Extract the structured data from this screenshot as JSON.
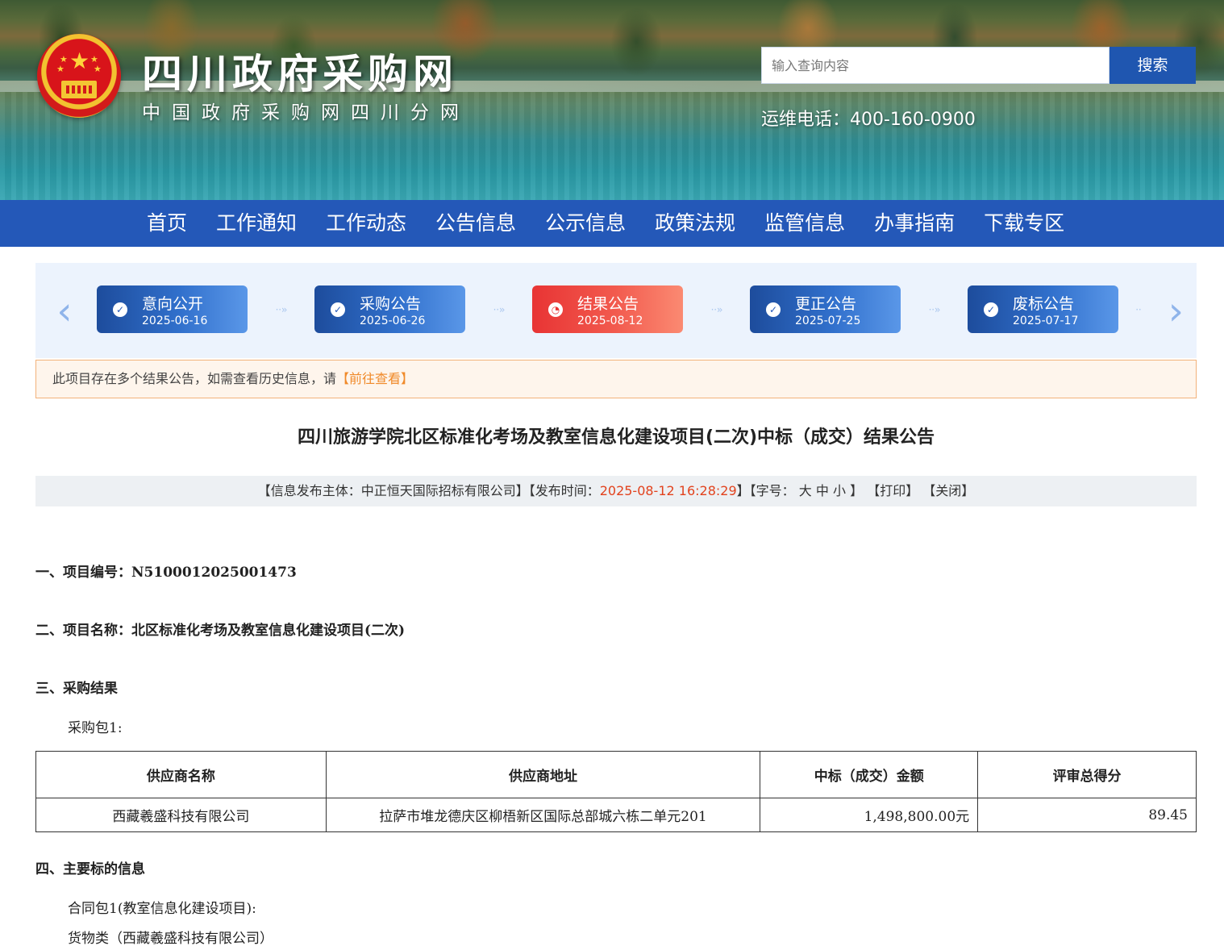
{
  "header": {
    "site_title": "四川政府采购网",
    "site_subtitle": "中国政府采购网四川分网",
    "search_placeholder": "输入查询内容",
    "search_button": "搜索",
    "hotline": "运维电话：400-160-0900"
  },
  "nav": {
    "items": [
      "首页",
      "工作通知",
      "工作动态",
      "公告信息",
      "公示信息",
      "政策法规",
      "监管信息",
      "办事指南",
      "下载专区"
    ]
  },
  "steps": [
    {
      "title": "意向公开",
      "date": "2025-06-16",
      "active": false
    },
    {
      "title": "采购公告",
      "date": "2025-06-26",
      "active": false
    },
    {
      "title": "结果公告",
      "date": "2025-08-12",
      "active": true
    },
    {
      "title": "更正公告",
      "date": "2025-07-25",
      "active": false
    },
    {
      "title": "废标公告",
      "date": "2025-07-17",
      "active": false
    }
  ],
  "notice": {
    "text": "此项目存在多个结果公告，如需查看历史信息，请",
    "link": "【前往查看】"
  },
  "article": {
    "title": "四川旅游学院北区标准化考场及教室信息化建设项目(二次)中标（成交）结果公告",
    "meta": {
      "publisher_prefix": "【信息发布主体：中正恒天国际招标有限公司】【发布时间：",
      "time": "2025-08-12 16:28:29",
      "fontsize_prefix": "】【字号：",
      "size_large": "大",
      "size_medium": "中",
      "size_small": "小",
      "fontsize_suffix": "】",
      "print": "【打印】",
      "close": "【关闭】"
    },
    "sections": {
      "s1": "一、项目编号：N5100012025001473",
      "s2": "二、项目名称：北区标准化考场及教室信息化建设项目(二次)",
      "s3": "三、采购结果",
      "s3_package": "采购包1:",
      "s4": "四、主要标的信息",
      "s4_contract": "合同包1(教室信息化建设项目):",
      "s4_category": "货物类（西藏羲盛科技有限公司）"
    },
    "result_table": {
      "headers": [
        "供应商名称",
        "供应商地址",
        "中标（成交）金额",
        "评审总得分"
      ],
      "rows": [
        [
          "西藏羲盛科技有限公司",
          "拉萨市堆龙德庆区柳梧新区国际总部城六栋二单元201",
          "1,498,800.00元",
          "89.45"
        ]
      ]
    }
  },
  "colors": {
    "nav_bg": "#2458b8",
    "step_active": "#e83434",
    "time_text": "#e2421d",
    "notice_link": "#f08a2a"
  }
}
